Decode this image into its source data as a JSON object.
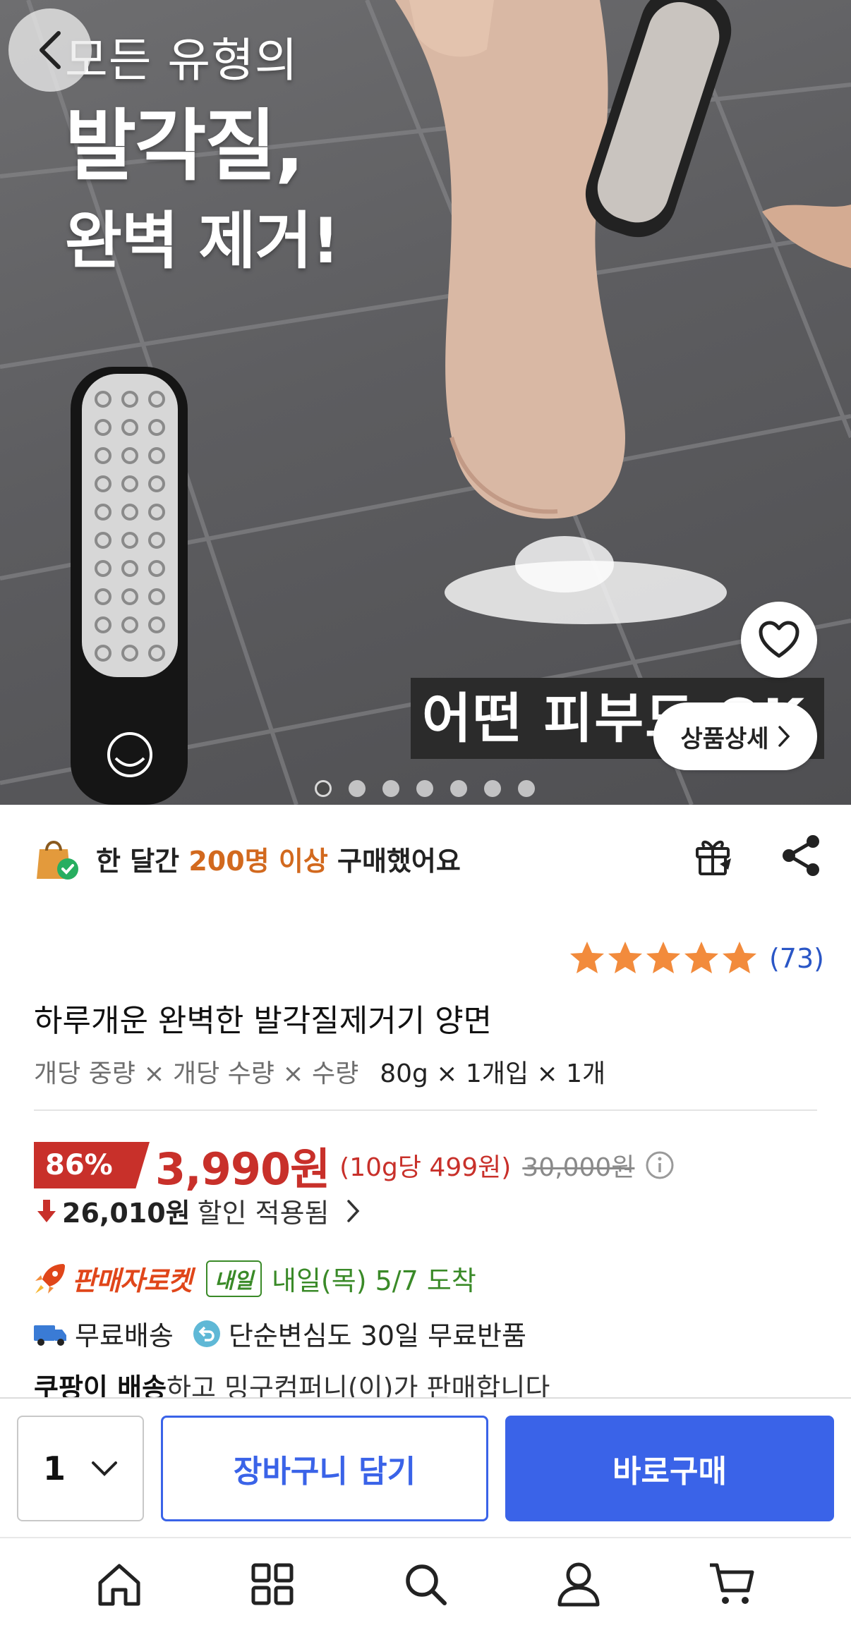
{
  "hero": {
    "headline_line1": "모든 유형의",
    "headline_line2": "발각질,",
    "headline_line3": "완벽 제거!",
    "caption": "어떤 피부도 OK",
    "detail_button": "상품상세",
    "slide_count": 7,
    "active_slide": 1
  },
  "purchase_stat": {
    "prefix": "한 달간 ",
    "highlight": "200명 이상",
    "suffix": " 구매했어요"
  },
  "rating": {
    "stars": 5,
    "count": "(73)"
  },
  "product": {
    "title": "하루개운 완벽한 발각질제거기 양면",
    "option_label": "개당 중량 × 개당 수량 × 수량",
    "option_value": "80g × 1개입 × 1개"
  },
  "price": {
    "discount": "86%",
    "sale_price": "3,990원",
    "unit_price": "(10g당 499원)",
    "original_price": "30,000원",
    "saved_amount": "26,010원",
    "saved_label": "할인 적용됨"
  },
  "delivery": {
    "rocket_label": "판매자로켓",
    "tomorrow_badge": "내일",
    "arrival": "내일(목) 5/7 도착",
    "free_shipping": "무료배송",
    "free_return": "단순변심도 30일 무료반품"
  },
  "seller": {
    "bold": "쿠팡이 배송",
    "text": "하고 밍구컴퍼니(이)가 판매합니다"
  },
  "buy_bar": {
    "quantity": "1",
    "cart_button": "장바구니 담기",
    "buy_button": "바로구매"
  },
  "tab_bar": {
    "items": [
      "home-icon",
      "category-grid-icon",
      "search-icon",
      "account-icon",
      "cart-icon"
    ]
  },
  "colors": {
    "accent_blue": "#3a63e8",
    "price_red": "#c8302a",
    "highlight_orange": "#d2691e",
    "rating_star": "#f28b3c",
    "delivery_green": "#3a8a28"
  }
}
